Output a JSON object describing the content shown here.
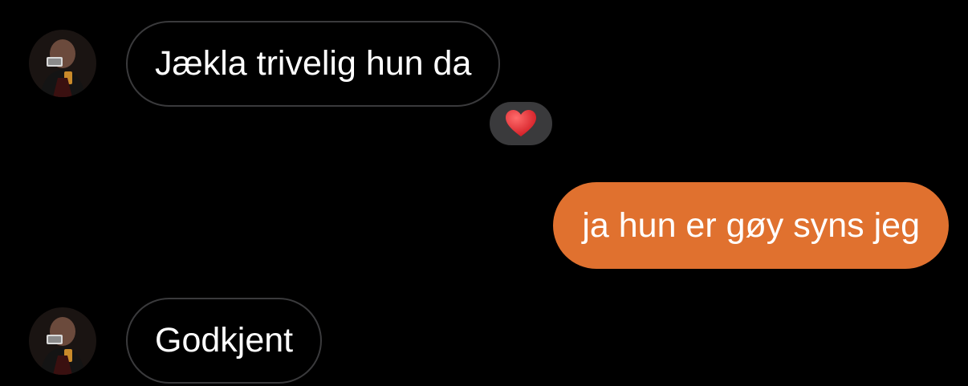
{
  "thread": {
    "messages": [
      {
        "direction": "incoming",
        "sender": "contact",
        "text": "Jækla trivelig hun da",
        "reaction": {
          "emoji": "heart-icon",
          "color": "#e0282e"
        }
      },
      {
        "direction": "outgoing",
        "sender": "me",
        "text": "ja hun er gøy syns jeg",
        "bubble_color": "#e0712f"
      },
      {
        "direction": "incoming",
        "sender": "contact",
        "text": "Godkjent"
      }
    ]
  },
  "colors": {
    "background": "#000000",
    "incoming_border": "#3a3a3c",
    "outgoing_bubble": "#e0712f",
    "reaction_pill": "#3a3a3c",
    "text": "#ffffff"
  }
}
